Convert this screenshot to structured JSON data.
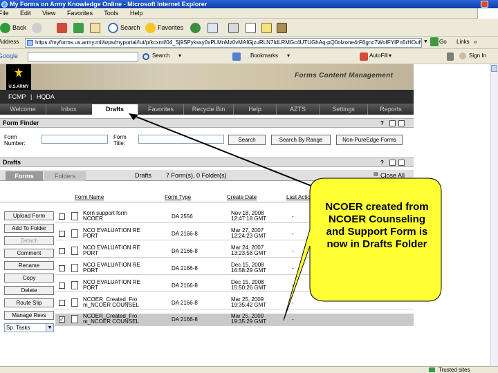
{
  "window": {
    "title": "My Forms on Army Knowledge Online - Microsoft Internet Explorer"
  },
  "menu": {
    "items": [
      "File",
      "Edit",
      "View",
      "Favorites",
      "Tools",
      "Help"
    ]
  },
  "toolbar": {
    "back": "Back",
    "search": "Search",
    "favorites": "Favorites"
  },
  "address": {
    "label": "Address",
    "url": "https://myforms.us.army.mil/wps/myportal/!ut/p/kcxml/04_Sj9SPykssy0xPLMnMz0vMAfGjzuRLN7IdLRMGc4UTUGhAq-pQ0olzone4rF6gnc7WoIFYIPn5rHOufvEYYfuMIoT5HcZkl",
    "go": "Go",
    "links": "Links"
  },
  "google_bar": {
    "brand": "Google",
    "search": "Search",
    "bookmarks": "Bookmarks",
    "autofill": "AutoFill",
    "signin": "Sign In"
  },
  "header": {
    "army_label": "U.S.ARMY",
    "product": "Forms Content Management"
  },
  "app_nav": [
    "FCMP",
    "|",
    "HQDA"
  ],
  "tabs": [
    "Welcome",
    "Inbox",
    "Drafts",
    "Favorites",
    "Recycle Bin",
    "Help",
    "AZTS",
    "Settings",
    "Reports"
  ],
  "form_finder": {
    "title": "Form Finder",
    "form_number_label": "Form Number:",
    "form_title_label": "Form Title:",
    "search_button": "Search",
    "search_by_range_button": "Search By Range",
    "non_pureedge_button": "Non-PureEdge Forms"
  },
  "drafts": {
    "title": "Drafts",
    "subtabs": {
      "forms": "Forms",
      "folders": "Folders"
    },
    "summary_prefix": "Drafts",
    "summary": "7 Form(s), 0 Folder(s)",
    "close_all": "Close All",
    "columns": [
      "Form Name",
      "Form Type",
      "Create Date",
      "Last Action"
    ],
    "side_buttons": [
      "Upload Form",
      "Add To Folder",
      "Detach",
      "Comment",
      "Rename",
      "Copy",
      "Delete",
      "Route Slip",
      "Manage Revs"
    ],
    "select_value": "Sp. Tasks",
    "rows": [
      {
        "name": [
          "Korn support form",
          "NCOER"
        ],
        "type": "DA 2556",
        "date": [
          "Nov 18, 2008",
          "12:47:18 GMT"
        ],
        "last": "-",
        "checked": false
      },
      {
        "name": [
          "NCO EVALUATION RE",
          "PORT"
        ],
        "type": "DA 2166-8",
        "date": [
          "Mar 27, 2007",
          "12:24:23 GMT"
        ],
        "last": "-",
        "checked": false
      },
      {
        "name": [
          "NCO EVALUATION RE",
          "PORT"
        ],
        "type": "DA 2166-8",
        "date": [
          "Mar 24, 2007",
          "13:23:58 GMT"
        ],
        "last": "-",
        "checked": false
      },
      {
        "name": [
          "NCO EVALUATION RE",
          "PORT"
        ],
        "type": "DA 2166-8",
        "date": [
          "Dec 15, 2008",
          "16:58:29 GMT"
        ],
        "last": "-",
        "checked": false
      },
      {
        "name": [
          "NCO EVALUATION RE",
          "PORT"
        ],
        "type": "DA 2166-8",
        "date": [
          "Dec 15, 2008",
          "15:50:26 GMT"
        ],
        "last": "-",
        "checked": false
      },
      {
        "name": [
          "NCOER_Created_Fro",
          "m_NCOER COUNSEL"
        ],
        "type": "DA 2166-8",
        "date": [
          "Mar 25, 2009",
          "19:35:42 GMT"
        ],
        "last": "-",
        "checked": false
      },
      {
        "name": [
          "NCOER_Created_Fro",
          "m_NCOER COUNSEL"
        ],
        "type": "DA 2166-8",
        "date": [
          "Mar 25, 2009",
          "19:35:29 GMT"
        ],
        "last": "-",
        "checked": true
      }
    ]
  },
  "callout": {
    "text": "NCOER created from NCOER Counseling and Support Form is now in Drafts Folder"
  },
  "status": {
    "zone": "Trusted sites"
  },
  "colors": {
    "callout_fill": "#ffff33",
    "nav_dark": "#2b2b2b",
    "panel_gray": "#dcdcdc"
  }
}
